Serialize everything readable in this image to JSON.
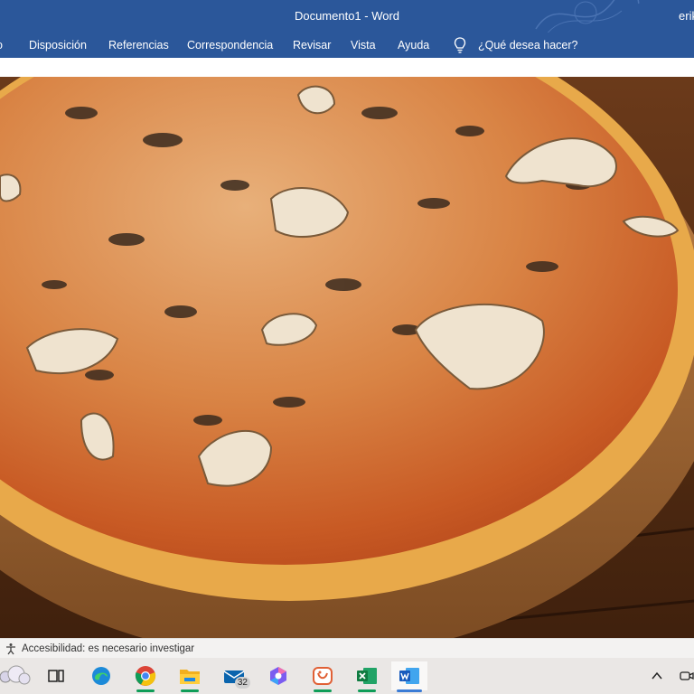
{
  "window": {
    "title": "Documento1  -  Word",
    "user": "erik"
  },
  "ribbon": {
    "tabs": [
      "o",
      "Disposición",
      "Referencias",
      "Correspondencia",
      "Revisar",
      "Vista",
      "Ayuda"
    ],
    "tell_me": "¿Qué desea hacer?"
  },
  "statusbar": {
    "accessibility": "Accesibilidad: es necesario investigar"
  },
  "taskbar": {
    "mail_badge": "32",
    "apps": [
      "widgets",
      "task-view",
      "edge",
      "chrome",
      "file-explorer",
      "mail",
      "copilot",
      "snipping-tool",
      "excel",
      "word"
    ]
  },
  "colors": {
    "word_blue": "#2b579a",
    "statusbar_bg": "#f3f2f1",
    "taskbar_bg": "#eae7e5"
  }
}
